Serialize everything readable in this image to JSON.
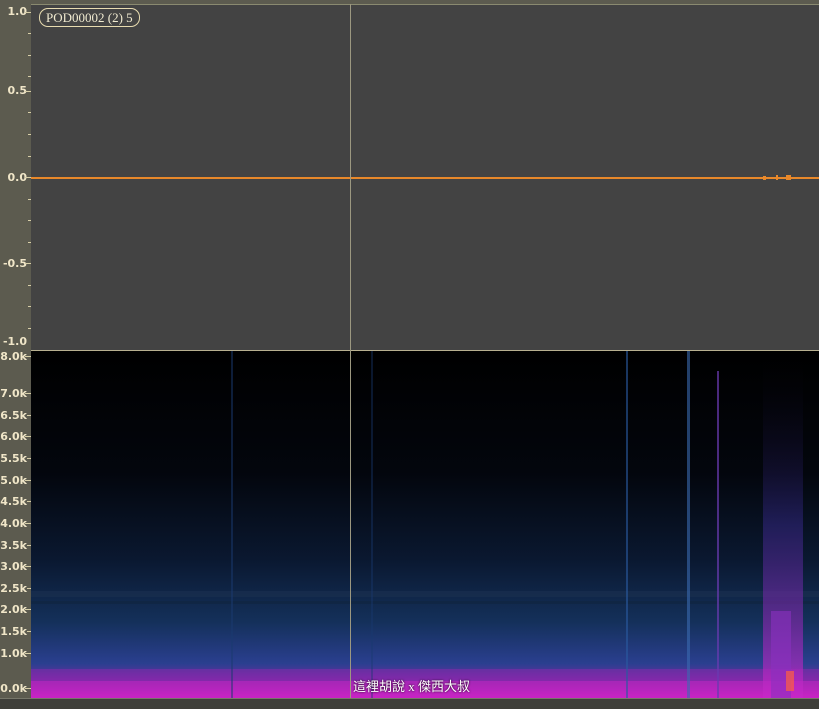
{
  "clip": {
    "label": "POD00002 (2) 5"
  },
  "waveform": {
    "ruler_labels": [
      "1.0",
      "0.5",
      "0.0",
      "-0.5",
      "-1.0"
    ],
    "line_color": "#e8882a",
    "background": "#434343"
  },
  "spectrogram": {
    "ruler_labels": [
      "8.0k",
      "7.0k",
      "6.5k",
      "6.0k",
      "5.5k",
      "5.0k",
      "4.5k",
      "4.0k",
      "3.5k",
      "3.0k",
      "2.5k",
      "2.0k",
      "1.5k",
      "1.0k",
      "0.0k"
    ],
    "low_color": "#d020c8",
    "mid_color": "#3060b0"
  },
  "caption": {
    "text": "這裡胡說 x 傑西大叔"
  }
}
